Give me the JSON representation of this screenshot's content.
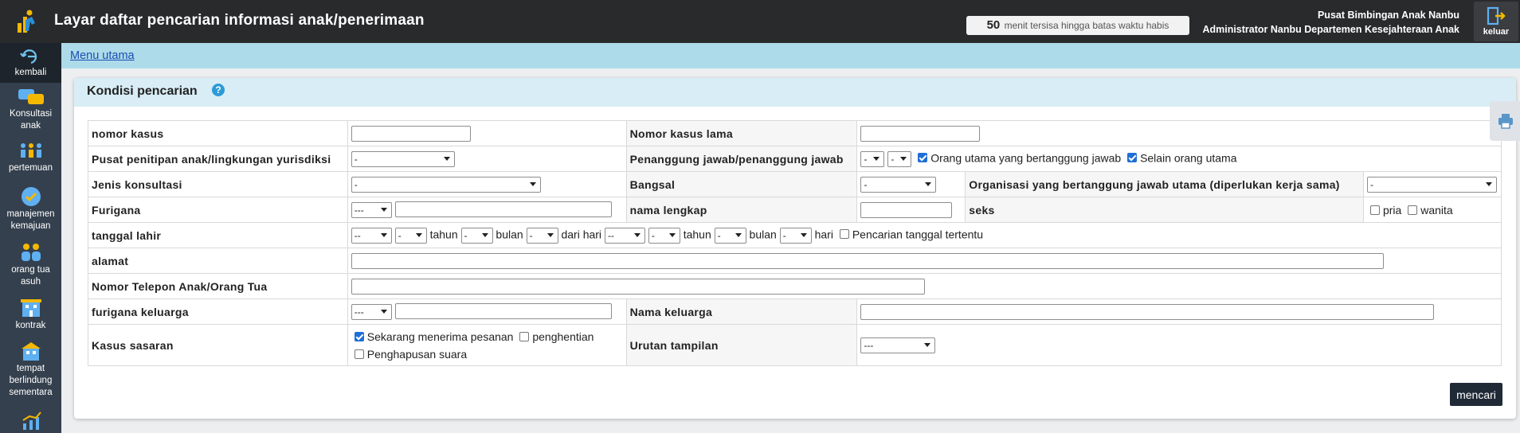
{
  "header": {
    "title": "Layar daftar pencarian informasi anak/penerimaan",
    "timer_value": "50",
    "timer_text": "menit tersisa hingga batas waktu habis",
    "office": "Pusat Bimbingan Anak Nanbu",
    "user": "Administrator Nanbu Departemen Kesejahteraan Anak",
    "logout_label": "keluar"
  },
  "sidebar": {
    "items": [
      {
        "label": "kembali",
        "icon": "back-icon"
      },
      {
        "label": "Konsultasi anak",
        "icon": "chat-icon"
      },
      {
        "label": "pertemuan",
        "icon": "meeting-icon"
      },
      {
        "label": "manajemen kemajuan",
        "icon": "check-icon"
      },
      {
        "label": "orang tua asuh",
        "icon": "family-icon"
      },
      {
        "label": "kontrak",
        "icon": "building-icon"
      },
      {
        "label": "tempat berlindung sementara",
        "icon": "shelter-icon"
      },
      {
        "label": "",
        "icon": "chart-icon"
      }
    ]
  },
  "breadcrumb": {
    "menu_label": "Menu utama"
  },
  "panel": {
    "title": "Kondisi pencarian",
    "help": "?"
  },
  "form": {
    "case_number": "nomor kasus",
    "old_case_number": "Nomor kasus lama",
    "center": "Pusat penitipan anak/lingkungan yurisdiksi",
    "center_value": "-",
    "person_in_charge": "Penanggung jawab/penanggung jawab",
    "pic_value_1": "-",
    "pic_value_2": "-",
    "main_person_label": "Orang utama yang bertanggung jawab",
    "other_than_main_label": "Selain orang utama",
    "consult_type": "Jenis konsultasi",
    "consult_type_value": "-",
    "ward": "Bangsal",
    "ward_value": "-",
    "org": "Organisasi yang bertanggung jawab utama (diperlukan kerja sama)",
    "org_value": "-",
    "furigana": "Furigana",
    "furigana_select": "---",
    "full_name": "nama lengkap",
    "sex": "seks",
    "male": "pria",
    "female": "wanita",
    "dob": "tanggal lahir",
    "dob_sel": "--",
    "dob_sel_short": "-",
    "year": "tahun",
    "month": "bulan",
    "from_day": "dari hari",
    "day": "hari",
    "specific_date": "Pencarian tanggal tertentu",
    "address": "alamat",
    "phone": "Nomor Telepon Anak/Orang Tua",
    "family_furigana": "furigana keluarga",
    "family_furigana_select": "---",
    "family_name": "Nama keluarga",
    "target_cases": "Kasus sasaran",
    "currently_accepting": "Sekarang menerima pesanan",
    "stopped": "penghentian",
    "voice_deletion": "Penghapusan suara",
    "display_order": "Urutan tampilan",
    "display_order_value": "---",
    "search_button": "mencari"
  },
  "colors": {
    "header_bg": "#292a2c",
    "sidebar_bg": "#34404e",
    "breadcrumb_bg": "#aedbea",
    "panel_head_bg": "#d8edf5",
    "button_bg": "#1f2a36"
  }
}
